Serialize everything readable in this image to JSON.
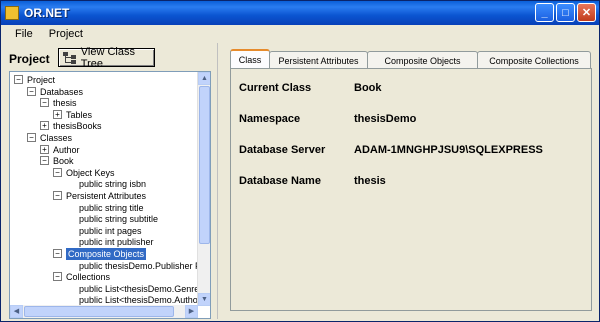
{
  "window": {
    "title": "OR.NET"
  },
  "menu": [
    "File",
    "Project"
  ],
  "left": {
    "project_label": "Project",
    "view_tree_button": "View Class Tree"
  },
  "tree": [
    {
      "label": "Project",
      "expander": "−"
    },
    {
      "label": "Databases",
      "expander": "−"
    },
    {
      "label": "thesis",
      "expander": "−"
    },
    {
      "label": "Tables",
      "expander": "+"
    },
    {
      "label": "thesisBooks",
      "expander": "+"
    },
    {
      "label": "Classes",
      "expander": "−"
    },
    {
      "label": "Author",
      "expander": "+"
    },
    {
      "label": "Book",
      "expander": "−"
    },
    {
      "label": "Object Keys",
      "expander": "−"
    },
    {
      "label": "public string isbn",
      "expander": ""
    },
    {
      "label": "Persistent Attributes",
      "expander": "−"
    },
    {
      "label": "public string title",
      "expander": ""
    },
    {
      "label": "public string subtitle",
      "expander": ""
    },
    {
      "label": "public int pages",
      "expander": ""
    },
    {
      "label": "public int publisher",
      "expander": ""
    },
    {
      "label": "Composite Objects",
      "expander": "−",
      "selected": true
    },
    {
      "label": "public thesisDemo.Publisher Pub",
      "expander": ""
    },
    {
      "label": "Collections",
      "expander": "−"
    },
    {
      "label": "public List<thesisDemo.Genre> G",
      "expander": ""
    },
    {
      "label": "public List<thesisDemo.Author>",
      "expander": ""
    }
  ],
  "tabs": [
    "Class",
    "Persistent Attributes",
    "Composite Objects",
    "Composite Collections"
  ],
  "class_info": {
    "current_class_label": "Current Class",
    "current_class_value": "Book",
    "namespace_label": "Namespace",
    "namespace_value": "thesisDemo",
    "server_label": "Database Server",
    "server_value": "ADAM-1MNGHPJSU9\\SQLEXPRESS",
    "dbname_label": "Database Name",
    "dbname_value": "thesis"
  }
}
